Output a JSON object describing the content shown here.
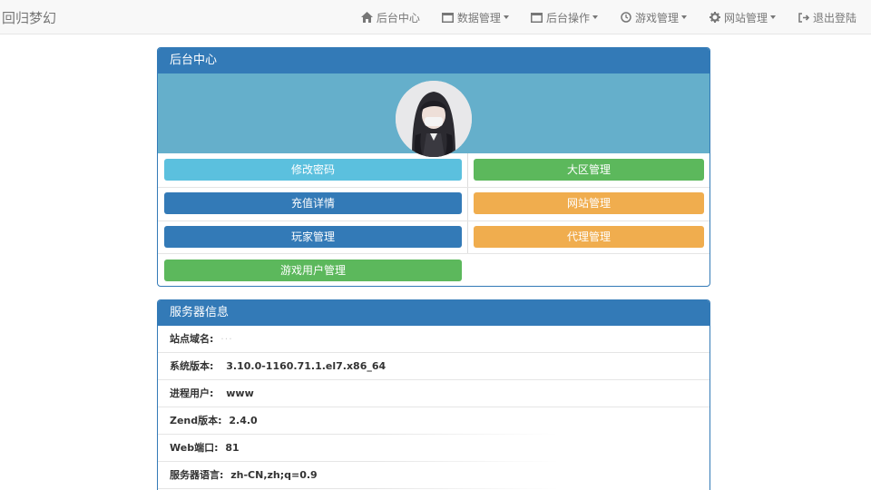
{
  "navbar": {
    "brand": "回归梦幻",
    "items": [
      {
        "label": "后台中心",
        "icon": "home-icon",
        "dropdown": false
      },
      {
        "label": "数据管理",
        "icon": "window-icon",
        "dropdown": true
      },
      {
        "label": "后台操作",
        "icon": "window-icon",
        "dropdown": true
      },
      {
        "label": "游戏管理",
        "icon": "clock-icon",
        "dropdown": true
      },
      {
        "label": "网站管理",
        "icon": "gear-icon",
        "dropdown": true
      },
      {
        "label": "退出登陆",
        "icon": "logout-icon",
        "dropdown": false
      }
    ]
  },
  "admin_panel": {
    "title": "后台中心",
    "buttons": {
      "change_password": "修改密码",
      "district_management": "大区管理",
      "recharge_details": "充值详情",
      "website_management": "网站管理",
      "player_management": "玩家管理",
      "agent_management": "代理管理",
      "game_user_management": "游戏用户管理"
    }
  },
  "server_panel": {
    "title": "服务器信息",
    "rows": [
      {
        "label": "站点域名:",
        "value": "···"
      },
      {
        "label": "系统版本:",
        "value": "3.10.0-1160.71.1.el7.x86_64"
      },
      {
        "label": "进程用户:",
        "value": "www"
      },
      {
        "label": "Zend版本:",
        "value": "2.4.0"
      },
      {
        "label": "Web端口:",
        "value": "81"
      },
      {
        "label": "服务器语言:",
        "value": "zh-CN,zh;q=0.9"
      }
    ]
  },
  "colors": {
    "primary": "#337ab7",
    "info": "#5bc0de",
    "success": "#5cb85c",
    "warning": "#f0ad4e",
    "avatar_band": "#65afcb"
  }
}
